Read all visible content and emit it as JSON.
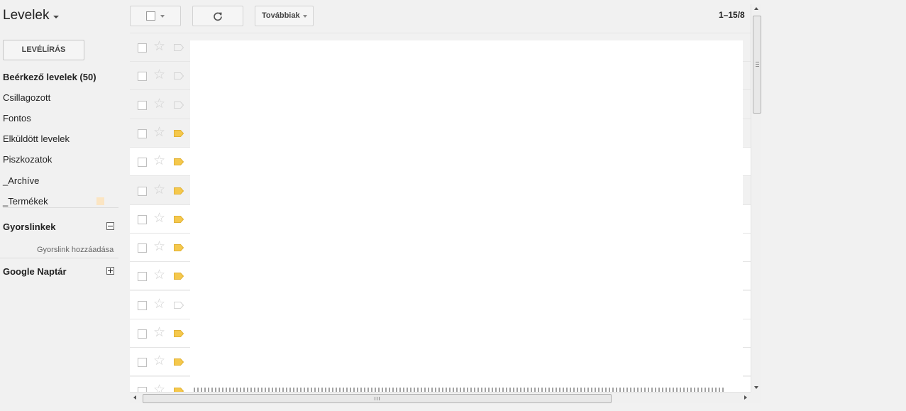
{
  "app": {
    "title": "Levelek"
  },
  "compose": {
    "label": "LEVÉLÍRÁS"
  },
  "nav": {
    "items": [
      {
        "label": "Beérkező levelek (50)",
        "bold": true
      },
      {
        "label": "Csillagozott",
        "bold": false
      },
      {
        "label": "Fontos",
        "bold": false
      },
      {
        "label": "Elküldött levelek",
        "bold": false
      },
      {
        "label": "Piszkozatok",
        "bold": false
      },
      {
        "label": "_Archíve",
        "bold": false
      },
      {
        "label": "_Termékek",
        "bold": false,
        "swatch_color": "#fbe5c3"
      }
    ]
  },
  "quicklinks": {
    "title": "Gyorslinkek",
    "toggle": "collapse",
    "add_label": "Gyorslink hozzáadása"
  },
  "calendar": {
    "title": "Google Naptár",
    "toggle": "expand"
  },
  "toolbar": {
    "more_label": "Továbbiak",
    "pager": "1–15/8"
  },
  "rows": [
    {
      "important": false,
      "highlight": true
    },
    {
      "important": false,
      "highlight": true
    },
    {
      "important": false,
      "highlight": true
    },
    {
      "important": true,
      "highlight": true
    },
    {
      "important": true,
      "highlight": false
    },
    {
      "important": true,
      "highlight": true
    },
    {
      "important": true,
      "highlight": false
    },
    {
      "important": true,
      "highlight": false
    },
    {
      "important": true,
      "highlight": false
    },
    {
      "important": false,
      "highlight": false
    },
    {
      "important": true,
      "highlight": false
    },
    {
      "important": true,
      "highlight": false
    },
    {
      "important": true,
      "highlight": false
    }
  ],
  "colors": {
    "important_marker": "#f5c84c",
    "label_swatch": "#fbe5c3",
    "star_empty": "#cfcfcf"
  }
}
